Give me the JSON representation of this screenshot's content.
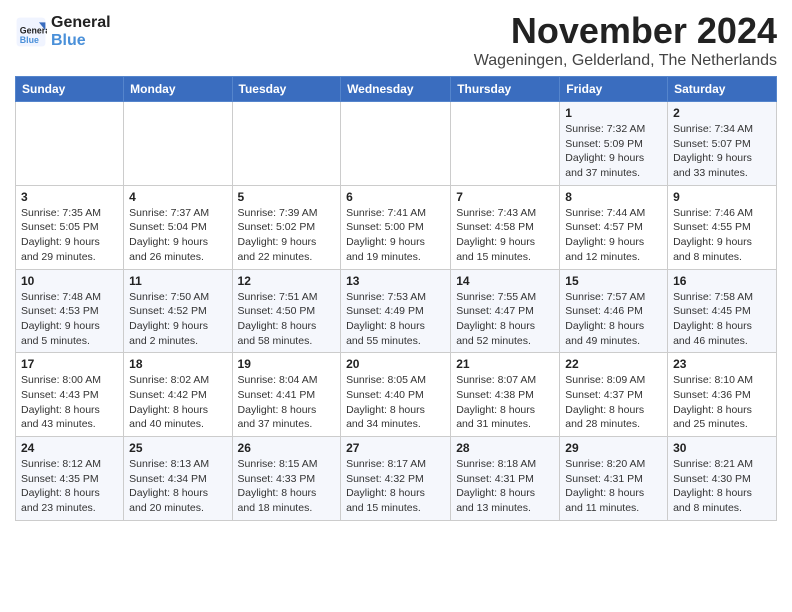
{
  "logo": {
    "line1": "General",
    "line2": "Blue"
  },
  "title": "November 2024",
  "location": "Wageningen, Gelderland, The Netherlands",
  "days_of_week": [
    "Sunday",
    "Monday",
    "Tuesday",
    "Wednesday",
    "Thursday",
    "Friday",
    "Saturday"
  ],
  "weeks": [
    [
      {
        "day": "",
        "info": ""
      },
      {
        "day": "",
        "info": ""
      },
      {
        "day": "",
        "info": ""
      },
      {
        "day": "",
        "info": ""
      },
      {
        "day": "",
        "info": ""
      },
      {
        "day": "1",
        "info": "Sunrise: 7:32 AM\nSunset: 5:09 PM\nDaylight: 9 hours and 37 minutes."
      },
      {
        "day": "2",
        "info": "Sunrise: 7:34 AM\nSunset: 5:07 PM\nDaylight: 9 hours and 33 minutes."
      }
    ],
    [
      {
        "day": "3",
        "info": "Sunrise: 7:35 AM\nSunset: 5:05 PM\nDaylight: 9 hours and 29 minutes."
      },
      {
        "day": "4",
        "info": "Sunrise: 7:37 AM\nSunset: 5:04 PM\nDaylight: 9 hours and 26 minutes."
      },
      {
        "day": "5",
        "info": "Sunrise: 7:39 AM\nSunset: 5:02 PM\nDaylight: 9 hours and 22 minutes."
      },
      {
        "day": "6",
        "info": "Sunrise: 7:41 AM\nSunset: 5:00 PM\nDaylight: 9 hours and 19 minutes."
      },
      {
        "day": "7",
        "info": "Sunrise: 7:43 AM\nSunset: 4:58 PM\nDaylight: 9 hours and 15 minutes."
      },
      {
        "day": "8",
        "info": "Sunrise: 7:44 AM\nSunset: 4:57 PM\nDaylight: 9 hours and 12 minutes."
      },
      {
        "day": "9",
        "info": "Sunrise: 7:46 AM\nSunset: 4:55 PM\nDaylight: 9 hours and 8 minutes."
      }
    ],
    [
      {
        "day": "10",
        "info": "Sunrise: 7:48 AM\nSunset: 4:53 PM\nDaylight: 9 hours and 5 minutes."
      },
      {
        "day": "11",
        "info": "Sunrise: 7:50 AM\nSunset: 4:52 PM\nDaylight: 9 hours and 2 minutes."
      },
      {
        "day": "12",
        "info": "Sunrise: 7:51 AM\nSunset: 4:50 PM\nDaylight: 8 hours and 58 minutes."
      },
      {
        "day": "13",
        "info": "Sunrise: 7:53 AM\nSunset: 4:49 PM\nDaylight: 8 hours and 55 minutes."
      },
      {
        "day": "14",
        "info": "Sunrise: 7:55 AM\nSunset: 4:47 PM\nDaylight: 8 hours and 52 minutes."
      },
      {
        "day": "15",
        "info": "Sunrise: 7:57 AM\nSunset: 4:46 PM\nDaylight: 8 hours and 49 minutes."
      },
      {
        "day": "16",
        "info": "Sunrise: 7:58 AM\nSunset: 4:45 PM\nDaylight: 8 hours and 46 minutes."
      }
    ],
    [
      {
        "day": "17",
        "info": "Sunrise: 8:00 AM\nSunset: 4:43 PM\nDaylight: 8 hours and 43 minutes."
      },
      {
        "day": "18",
        "info": "Sunrise: 8:02 AM\nSunset: 4:42 PM\nDaylight: 8 hours and 40 minutes."
      },
      {
        "day": "19",
        "info": "Sunrise: 8:04 AM\nSunset: 4:41 PM\nDaylight: 8 hours and 37 minutes."
      },
      {
        "day": "20",
        "info": "Sunrise: 8:05 AM\nSunset: 4:40 PM\nDaylight: 8 hours and 34 minutes."
      },
      {
        "day": "21",
        "info": "Sunrise: 8:07 AM\nSunset: 4:38 PM\nDaylight: 8 hours and 31 minutes."
      },
      {
        "day": "22",
        "info": "Sunrise: 8:09 AM\nSunset: 4:37 PM\nDaylight: 8 hours and 28 minutes."
      },
      {
        "day": "23",
        "info": "Sunrise: 8:10 AM\nSunset: 4:36 PM\nDaylight: 8 hours and 25 minutes."
      }
    ],
    [
      {
        "day": "24",
        "info": "Sunrise: 8:12 AM\nSunset: 4:35 PM\nDaylight: 8 hours and 23 minutes."
      },
      {
        "day": "25",
        "info": "Sunrise: 8:13 AM\nSunset: 4:34 PM\nDaylight: 8 hours and 20 minutes."
      },
      {
        "day": "26",
        "info": "Sunrise: 8:15 AM\nSunset: 4:33 PM\nDaylight: 8 hours and 18 minutes."
      },
      {
        "day": "27",
        "info": "Sunrise: 8:17 AM\nSunset: 4:32 PM\nDaylight: 8 hours and 15 minutes."
      },
      {
        "day": "28",
        "info": "Sunrise: 8:18 AM\nSunset: 4:31 PM\nDaylight: 8 hours and 13 minutes."
      },
      {
        "day": "29",
        "info": "Sunrise: 8:20 AM\nSunset: 4:31 PM\nDaylight: 8 hours and 11 minutes."
      },
      {
        "day": "30",
        "info": "Sunrise: 8:21 AM\nSunset: 4:30 PM\nDaylight: 8 hours and 8 minutes."
      }
    ]
  ]
}
